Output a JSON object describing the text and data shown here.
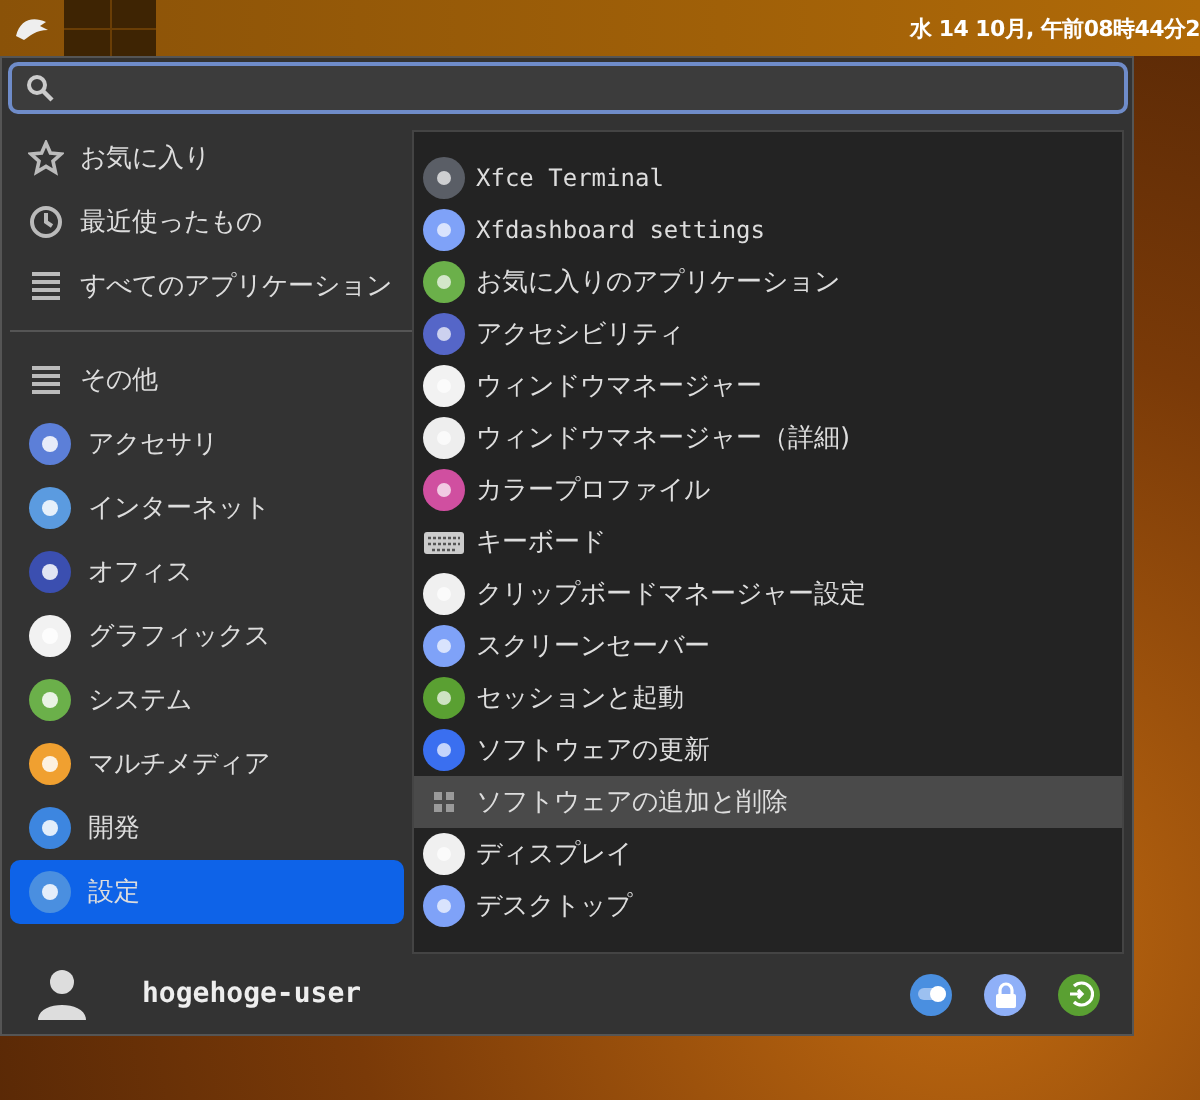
{
  "panel": {
    "clock": "水 14 10月, 午前08時44分2"
  },
  "sidebar": {
    "items": [
      {
        "label": "お気に入り",
        "kind": "star",
        "selected": false
      },
      {
        "label": "最近使ったもの",
        "kind": "clock",
        "selected": false
      },
      {
        "label": "すべてのアプリケーション",
        "kind": "list",
        "selected": false
      },
      {
        "kind": "separator"
      },
      {
        "label": "その他",
        "kind": "list",
        "selected": false
      },
      {
        "label": "アクセサリ",
        "kind": "app",
        "color": "#5c7fd8",
        "selected": false
      },
      {
        "label": "インターネット",
        "kind": "app",
        "color": "#5b9be0",
        "selected": false
      },
      {
        "label": "オフィス",
        "kind": "app",
        "color": "#3b4fb0",
        "selected": false
      },
      {
        "label": "グラフィックス",
        "kind": "app",
        "color": "#f2f2f2",
        "selected": false
      },
      {
        "label": "システム",
        "kind": "app",
        "color": "#6bb04a",
        "selected": false
      },
      {
        "label": "マルチメディア",
        "kind": "app",
        "color": "#f0a030",
        "selected": false
      },
      {
        "label": "開発",
        "kind": "app",
        "color": "#3d86e0",
        "selected": false
      },
      {
        "label": "設定",
        "kind": "app",
        "color": "#4a8fe0",
        "selected": true
      }
    ]
  },
  "apps": [
    {
      "label": "Xfce Terminal",
      "kind": "app",
      "color": "#5a5e66",
      "selected": false
    },
    {
      "label": "Xfdashboard settings",
      "kind": "app",
      "color": "#7fa2f8",
      "selected": false
    },
    {
      "label": "お気に入りのアプリケーション",
      "kind": "app",
      "color": "#6bb04a",
      "selected": false
    },
    {
      "label": "アクセシビリティ",
      "kind": "app",
      "color": "#5566c8",
      "selected": false
    },
    {
      "label": "ウィンドウマネージャー",
      "kind": "app",
      "color": "#f2f2f2",
      "selected": false
    },
    {
      "label": "ウィンドウマネージャー（詳細)",
      "kind": "app",
      "color": "#eeeeee",
      "selected": false
    },
    {
      "label": "カラープロファイル",
      "kind": "app",
      "color": "#d04fa0",
      "selected": false
    },
    {
      "label": "キーボード",
      "kind": "keyboard",
      "color": "#cccccc",
      "selected": false
    },
    {
      "label": "クリップボードマネージャー設定",
      "kind": "app",
      "color": "#f0f0f0",
      "selected": false
    },
    {
      "label": "スクリーンセーバー",
      "kind": "app",
      "color": "#7fa2f8",
      "selected": false
    },
    {
      "label": "セッションと起動",
      "kind": "app",
      "color": "#5aa032",
      "selected": false
    },
    {
      "label": "ソフトウェアの更新",
      "kind": "app",
      "color": "#3a6ff0",
      "selected": false
    },
    {
      "label": "ソフトウェアの追加と削除",
      "kind": "grid",
      "color": "#9a9a9a",
      "selected": true
    },
    {
      "label": "ディスプレイ",
      "kind": "app",
      "color": "#f0f0f0",
      "selected": false
    },
    {
      "label": "デスクトップ",
      "kind": "app",
      "color": "#7fa2f8",
      "selected": false
    }
  ],
  "user": {
    "name": "hogehoge-user"
  }
}
